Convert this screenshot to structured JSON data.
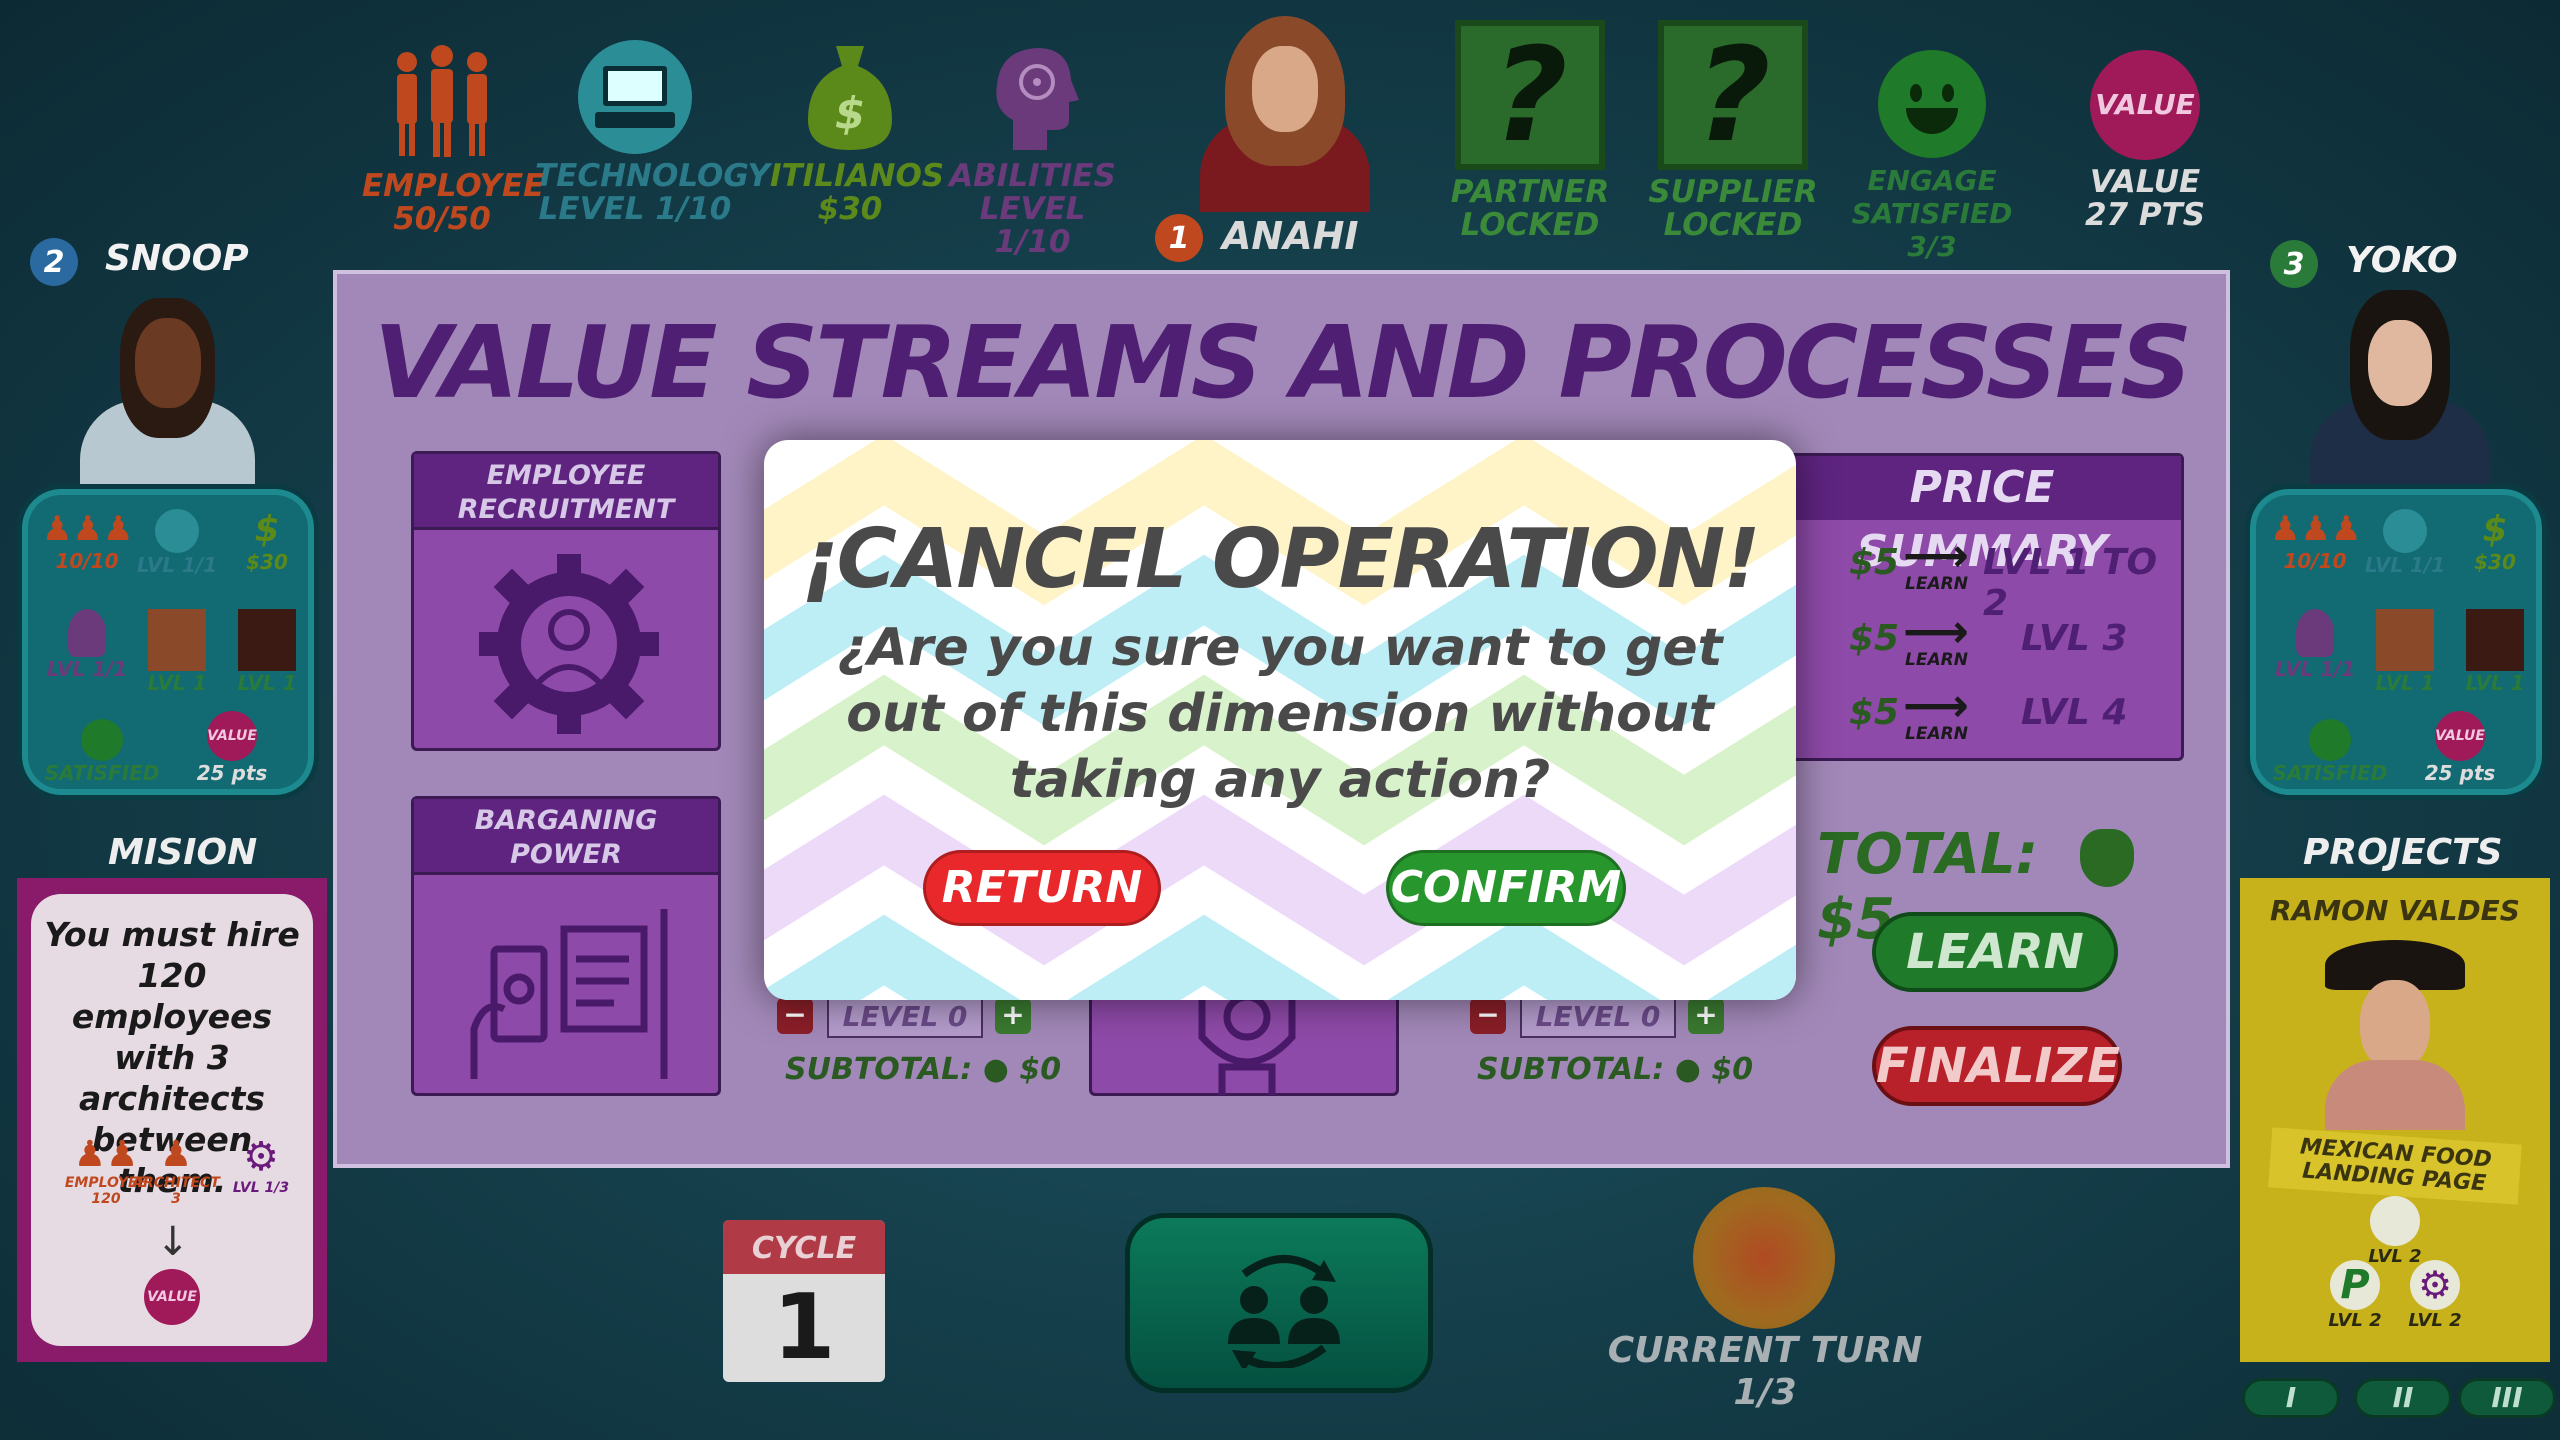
{
  "top_stats": {
    "employee": {
      "label": "EMPLOYEE",
      "value": "50/50",
      "color": "#c0481e"
    },
    "technology": {
      "label": "TECHNOLOGY",
      "value": "LEVEL  1/10",
      "color": "#2a7a8a"
    },
    "itilianos": {
      "label": "ITILIANOS",
      "value": "$30",
      "color": "#5c8a1a"
    },
    "abilities": {
      "label": "ABILITIES",
      "value": "LEVEL  1/10",
      "color": "#6a3a7a"
    },
    "current_player": {
      "number": "1",
      "name": "ANAHI"
    },
    "partner": {
      "label": "PARTNER",
      "value": "LOCKED"
    },
    "supplier": {
      "label": "SUPPLIER",
      "value": "LOCKED"
    },
    "engage": {
      "label": "ENGAGE",
      "value": "SATISFIED",
      "count": "3/3"
    },
    "value": {
      "badge": "VALUE",
      "label": "VALUE",
      "points": "27 PTS"
    }
  },
  "left_player": {
    "number": "2",
    "name": "SNOOP",
    "employees": "10/10",
    "tech": "LVL 1/1",
    "money": "$30",
    "ability": "LVL 1/1",
    "partner_lvl": "LVL 1",
    "supplier_lvl": "LVL 1",
    "status": "SATISFIED",
    "value_badge": "VALUE",
    "points": "25 pts"
  },
  "right_player": {
    "number": "3",
    "name": "YOKO",
    "employees": "10/10",
    "tech": "LVL 1/1",
    "money": "$30",
    "ability": "LVL 1/1",
    "partner_lvl": "LVL 1",
    "supplier_lvl": "LVL 1",
    "status": "SATISFIED",
    "value_badge": "VALUE",
    "points": "25 pts"
  },
  "board": {
    "title": "VALUE STREAMS AND PROCESSES",
    "tiles": [
      {
        "title_line1": "EMPLOYEE",
        "title_line2": "RECRUITMENT"
      },
      {
        "title_line1": "BARGANING",
        "title_line2": "POWER"
      }
    ],
    "level_controls": [
      {
        "level": "LEVEL 0",
        "subtotal_label": "SUBTOTAL:",
        "subtotal": "$0"
      },
      {
        "level": "LEVEL 0",
        "subtotal_label": "SUBTOTAL:",
        "subtotal": "$0"
      }
    ],
    "price_summary": {
      "title": "PRICE SUMMARY",
      "rows": [
        {
          "price": "$5",
          "action": "LEARN",
          "level": "LVL 1 TO 2"
        },
        {
          "price": "$5",
          "action": "LEARN",
          "level": "LVL 3"
        },
        {
          "price": "$5",
          "action": "LEARN",
          "level": "LVL 4"
        }
      ]
    },
    "total_label": "TOTAL:",
    "total_value": "$5",
    "learn_button": "LEARN",
    "finalize_button": "FINALIZE"
  },
  "modal": {
    "title": "¡CANCEL OPERATION!",
    "body": "¿Are you sure you want to get out of this dimension without taking any action?",
    "return_button": "RETURN",
    "confirm_button": "CONFIRM",
    "return_color": "#e8282a",
    "confirm_color": "#27962d"
  },
  "mission": {
    "title": "MISION",
    "text": "You must hire 120 employees with 3 architects between them.",
    "employee_label": "EMPLOYEE",
    "employee_count": "120",
    "architect_label": "ARCHITECT",
    "architect_count": "3",
    "level_label": "LVL 1/3",
    "value_badge": "VALUE"
  },
  "projects": {
    "title": "PROJECTS",
    "card_name": "RAMON VALDES",
    "card_ribbon": "MEXICAN FOOD LANDING PAGE",
    "req1": "LVL 2",
    "req2": "LVL 2",
    "req3": "LVL 2",
    "pages": [
      "I",
      "II",
      "III"
    ]
  },
  "cycle": {
    "label": "CYCLE",
    "number": "1"
  },
  "turn": {
    "label": "CURRENT TURN",
    "value": "1/3"
  }
}
